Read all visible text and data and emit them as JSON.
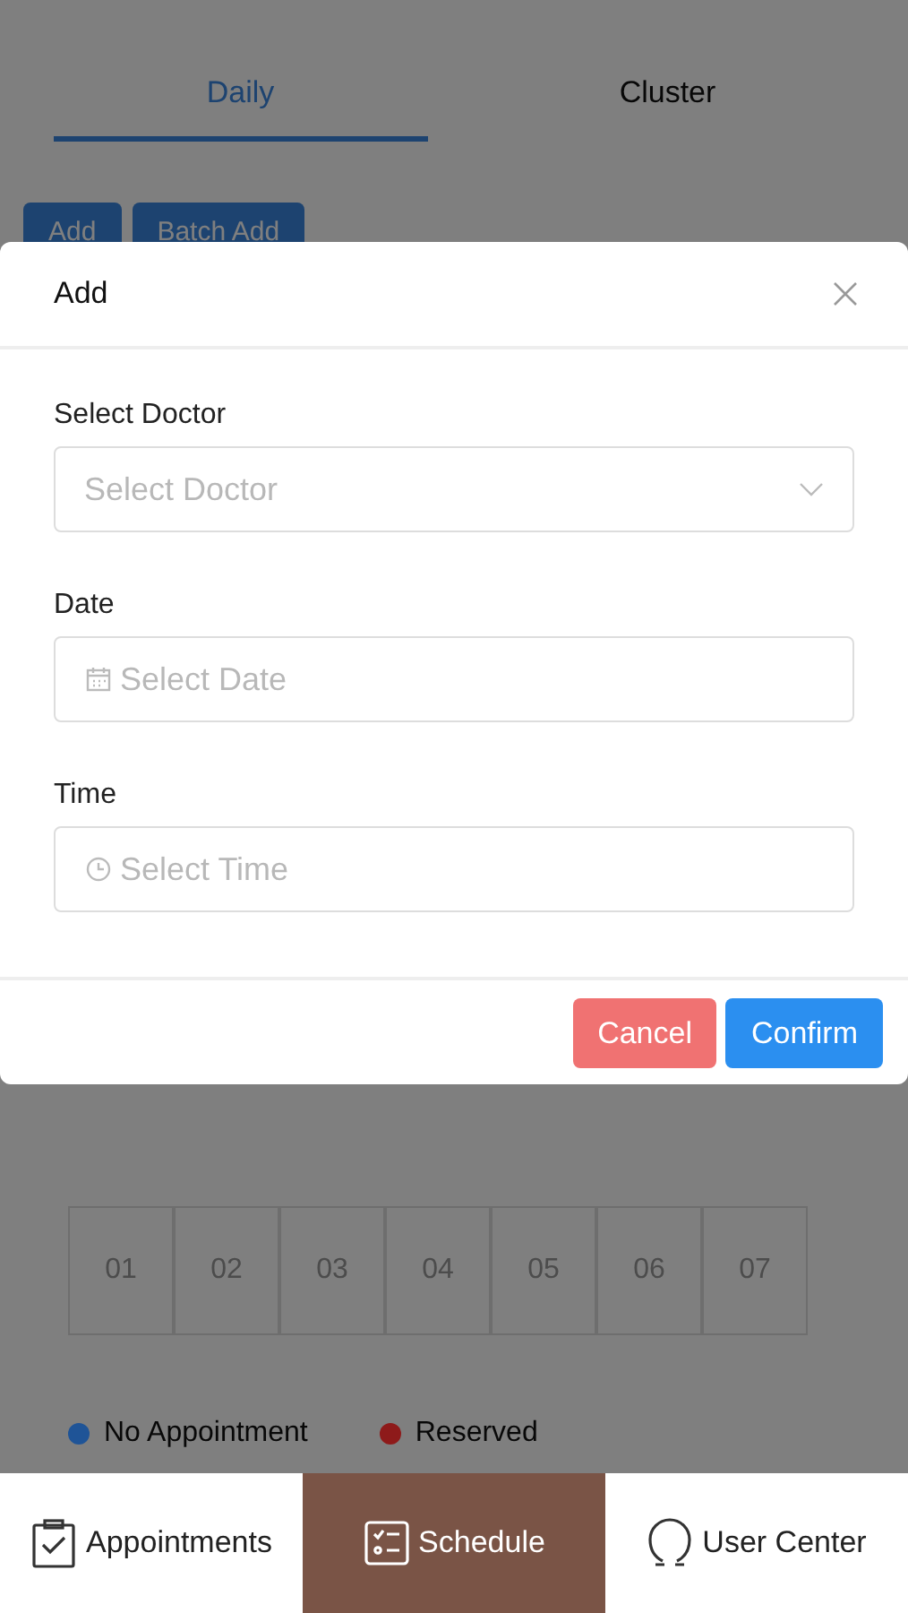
{
  "tabs": [
    {
      "label": "Daily",
      "selected": true
    },
    {
      "label": "Cluster",
      "selected": false
    }
  ],
  "actions": [
    "Add",
    "Batch Add"
  ],
  "days": [
    "01",
    "02",
    "03",
    "04",
    "05",
    "06",
    "07"
  ],
  "legend": [
    {
      "label": "No Appointment",
      "color": "#1f5497"
    },
    {
      "label": "Reserved",
      "color": "#8e1a1a"
    }
  ],
  "modal": {
    "title": "Add",
    "fields": [
      {
        "label": "Select Doctor",
        "placeholder": "Select Doctor",
        "kind": "select"
      },
      {
        "label": "Date",
        "placeholder": "Select Date",
        "kind": "date"
      },
      {
        "label": "Time",
        "placeholder": "Select Time",
        "kind": "time"
      }
    ],
    "buttons": [
      {
        "label": "Cancel",
        "kind": "danger"
      },
      {
        "label": "Confirm",
        "kind": "primary"
      }
    ]
  },
  "nav": [
    {
      "label": "Appointments",
      "selected": false,
      "kind": "appointments"
    },
    {
      "label": "Schedule",
      "selected": true,
      "kind": "schedule"
    },
    {
      "label": "User Center",
      "selected": false,
      "kind": "user"
    }
  ]
}
